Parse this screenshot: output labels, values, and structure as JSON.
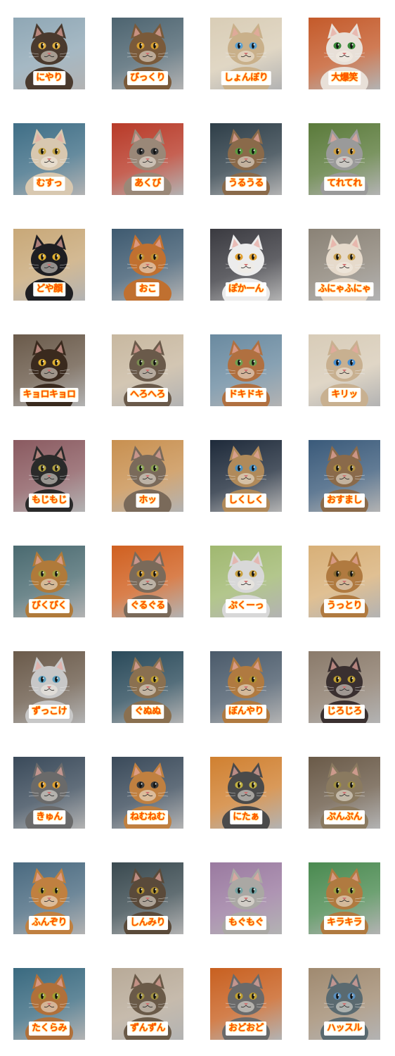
{
  "stickers": [
    {
      "label": "にやり",
      "bg": "#8fa7b5",
      "fur": "#4a3a2e",
      "eye": "#e0b040"
    },
    {
      "label": "びっくり",
      "bg": "#4d6470",
      "fur": "#7a5a3a",
      "eye": "#d8a030"
    },
    {
      "label": "しょんぼり",
      "bg": "#d9cdb6",
      "fur": "#c9b08a",
      "eye": "#5aa0d0"
    },
    {
      "label": "大爆笑",
      "bg": "#c45a2a",
      "fur": "#e8e0d8",
      "eye": "#3a8a3a"
    },
    {
      "label": "むすっ",
      "bg": "#3f6e86",
      "fur": "#d8c8b0",
      "eye": "#c0a040"
    },
    {
      "label": "あくび",
      "bg": "#b83a28",
      "fur": "#9a8878",
      "eye": "#3a3a3a"
    },
    {
      "label": "うるうる",
      "bg": "#2e3e48",
      "fur": "#8a6a4a",
      "eye": "#5a9a40"
    },
    {
      "label": "てれてれ",
      "bg": "#5a7a3a",
      "fur": "#9a9a9a",
      "eye": "#d0a040"
    },
    {
      "label": "どや顔",
      "bg": "#c8a878",
      "fur": "#1e1e22",
      "eye": "#e0b030"
    },
    {
      "label": "おこ",
      "bg": "#3e5a70",
      "fur": "#c07030",
      "eye": "#c09030"
    },
    {
      "label": "ぽかーん",
      "bg": "#3a3a40",
      "fur": "#ececec",
      "eye": "#e0a030"
    },
    {
      "label": "ふにゃふにゃ",
      "bg": "#8a8276",
      "fur": "#e6dacb",
      "eye": "#c8a050"
    },
    {
      "label": "キョロキョロ",
      "bg": "#6a5a4a",
      "fur": "#3a2a1e",
      "eye": "#e0b030"
    },
    {
      "label": "へろへろ",
      "bg": "#c8b8a0",
      "fur": "#6a5a4a",
      "eye": "#7a8a50"
    },
    {
      "label": "ドキドキ",
      "bg": "#6a8aa0",
      "fur": "#b07040",
      "eye": "#70a050"
    },
    {
      "label": "キリッ",
      "bg": "#d8ccb8",
      "fur": "#c8b090",
      "eye": "#4a90d0"
    },
    {
      "label": "もじもじ",
      "bg": "#8a5a60",
      "fur": "#2a2a2a",
      "eye": "#b0a040"
    },
    {
      "label": "ホッ",
      "bg": "#c89050",
      "fur": "#7a6a5a",
      "eye": "#8aa050"
    },
    {
      "label": "しくしく",
      "bg": "#1e2a3a",
      "fur": "#b08a5a",
      "eye": "#4a90c0"
    },
    {
      "label": "おすまし",
      "bg": "#3a5a7a",
      "fur": "#8a6a4a",
      "eye": "#b09040"
    },
    {
      "label": "びくびく",
      "bg": "#4a6a70",
      "fur": "#b07a3a",
      "eye": "#a0a040"
    },
    {
      "label": "ぐるぐる",
      "bg": "#d06020",
      "fur": "#7a6a5a",
      "eye": "#c09030"
    },
    {
      "label": "ぷくーっ",
      "bg": "#a0b870",
      "fur": "#d8d8d8",
      "eye": "#c8a040"
    },
    {
      "label": "うっとり",
      "bg": "#d8b078",
      "fur": "#b07a40",
      "eye": "#8a6a30"
    },
    {
      "label": "ずっこけ",
      "bg": "#6a5a4a",
      "fur": "#c8c8c8",
      "eye": "#5aa0c0"
    },
    {
      "label": "ぐぬぬ",
      "bg": "#2a4a5a",
      "fur": "#8a7050",
      "eye": "#c0a030"
    },
    {
      "label": "ぼんやり",
      "bg": "#4a5a6a",
      "fur": "#b07a40",
      "eye": "#b09030"
    },
    {
      "label": "じろじろ",
      "bg": "#8a7a6a",
      "fur": "#3a3030",
      "eye": "#c0a030"
    },
    {
      "label": "きゅん",
      "bg": "#3a4a5a",
      "fur": "#6a6a6a",
      "eye": "#e0a030"
    },
    {
      "label": "ねむねむ",
      "bg": "#3a4a5a",
      "fur": "#c08040",
      "eye": "#3a3a3a"
    },
    {
      "label": "にたぁ",
      "bg": "#d08030",
      "fur": "#4a4a4a",
      "eye": "#c0b040"
    },
    {
      "label": "ぷんぷん",
      "bg": "#6a5a48",
      "fur": "#8a7a60",
      "eye": "#a09040"
    },
    {
      "label": "ふんぞり",
      "bg": "#4a6a80",
      "fur": "#c08040",
      "eye": "#b09030"
    },
    {
      "label": "しんみり",
      "bg": "#3a4a50",
      "fur": "#5a4a3a",
      "eye": "#b09030"
    },
    {
      "label": "もぐもぐ",
      "bg": "#9a7aa0",
      "fur": "#aaa8a4",
      "eye": "#70a0a0"
    },
    {
      "label": "キラキラ",
      "bg": "#4a8a50",
      "fur": "#b07a40",
      "eye": "#a0a040"
    },
    {
      "label": "たくらみ",
      "bg": "#3a6a80",
      "fur": "#b0703a",
      "eye": "#a0a030"
    },
    {
      "label": "ずんずん",
      "bg": "#b8aa98",
      "fur": "#6a5a48",
      "eye": "#a09040"
    },
    {
      "label": "おどおど",
      "bg": "#c86020",
      "fur": "#6a6a6a",
      "eye": "#c0a030"
    },
    {
      "label": "ハッスル",
      "bg": "#a08a70",
      "fur": "#5a6a70",
      "eye": "#5a90c0"
    }
  ]
}
